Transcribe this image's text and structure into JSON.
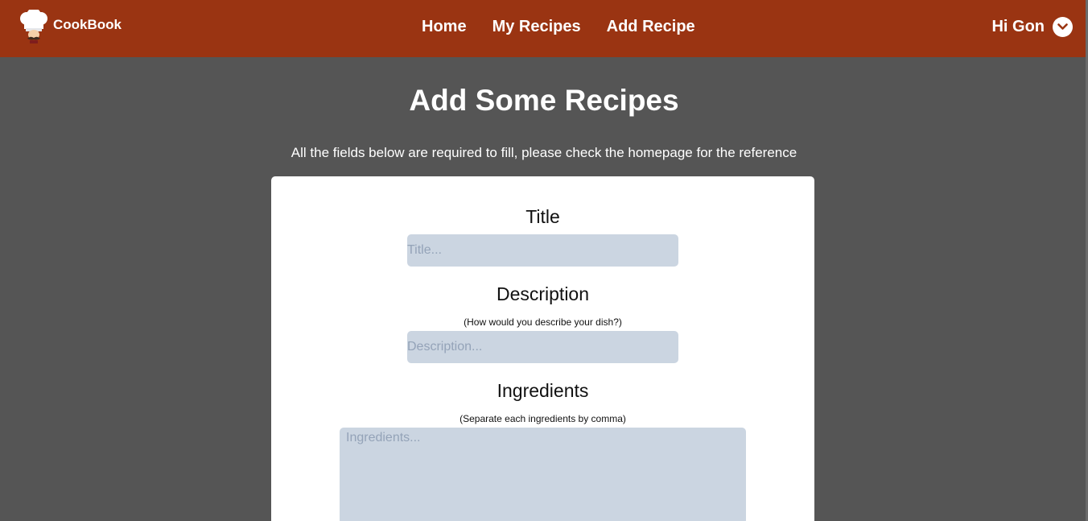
{
  "navbar": {
    "brand": "CookBook",
    "links": [
      "Home",
      "My Recipes",
      "Add Recipe"
    ],
    "greeting": "Hi Gon"
  },
  "main": {
    "title": "Add Some Recipes",
    "subtitle": "All the fields below are required to fill, please check the homepage for the reference"
  },
  "form": {
    "title_label": "Title",
    "title_placeholder": "Title...",
    "description_label": "Description",
    "description_hint": "(How would you describe your dish?)",
    "description_placeholder": "Description...",
    "ingredients_label": "Ingredients",
    "ingredients_hint": "(Separate each ingredients by comma)",
    "ingredients_placeholder": "Ingredients..."
  },
  "icons": {
    "logo": "chef-hat-icon",
    "user_menu": "chevron-down-icon"
  },
  "colors": {
    "navbar": "#9a3412",
    "page_background": "#555555",
    "card": "#ffffff",
    "input": "#cbd5e1"
  }
}
